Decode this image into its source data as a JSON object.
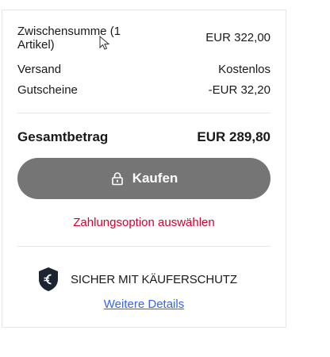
{
  "summary": {
    "subtotal_label": "Zwischensumme (1 Artikel)",
    "subtotal_value": "EUR 322,00",
    "shipping_label": "Versand",
    "shipping_value": "Kostenlos",
    "vouchers_label": "Gutscheine",
    "vouchers_value": "-EUR 32,20",
    "total_label": "Gesamtbetrag",
    "total_value": "EUR 289,80"
  },
  "buy_button": {
    "label": "Kaufen",
    "icon": "lock-icon"
  },
  "payment_prompt": "Zahlungsoption auswählen",
  "protection": {
    "label": "SICHER MIT KÄUFERSCHUTZ",
    "link": "Weitere Details",
    "icon": "euro-shield-icon"
  },
  "colors": {
    "button_bg": "#757575",
    "error_red": "#d6002d",
    "link_blue": "#3665f3"
  }
}
